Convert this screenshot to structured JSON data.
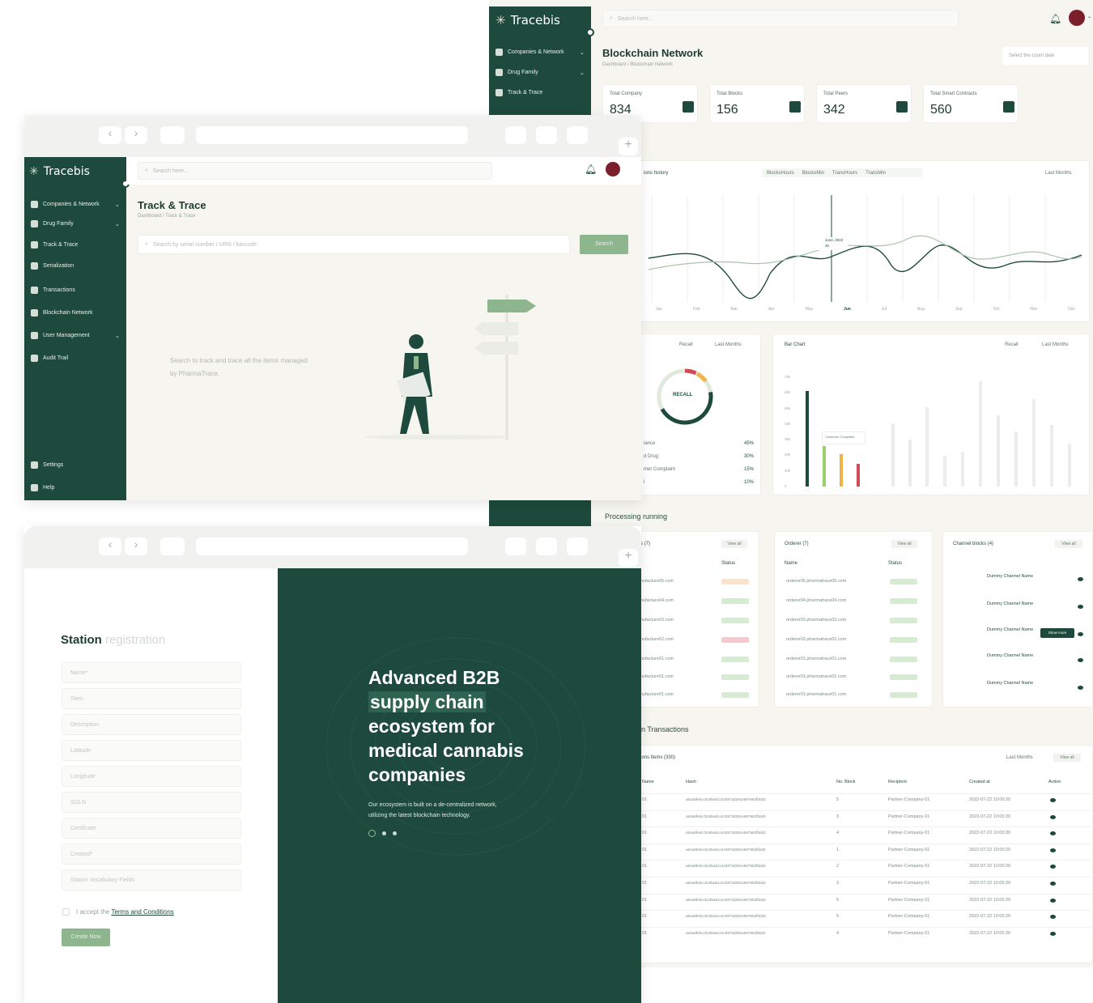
{
  "brand": {
    "name": "Tracebis"
  },
  "sidebar": {
    "items": [
      {
        "label": "Companies & Network",
        "has_chevron": true
      },
      {
        "label": "Drug Family",
        "has_chevron": true
      },
      {
        "label": "Track & Trace",
        "has_chevron": false
      },
      {
        "label": "Serialization",
        "has_chevron": false
      },
      {
        "label": "Transactions",
        "has_chevron": false
      },
      {
        "label": "Blockchain Network",
        "has_chevron": false
      },
      {
        "label": "User Management",
        "has_chevron": true
      },
      {
        "label": "Audit Trail",
        "has_chevron": false
      }
    ],
    "bottom": [
      {
        "label": "Settings"
      },
      {
        "label": "Help"
      }
    ]
  },
  "dashboard": {
    "search_placeholder": "Search here...",
    "title": "Blockchain Network",
    "breadcrumb": "Dashboard / Blockchain Network",
    "date_select": "Select the count date",
    "stats": [
      {
        "label": "Total Company",
        "value": "834"
      },
      {
        "label": "Total Blocks",
        "value": "156"
      },
      {
        "label": "Total Peers",
        "value": "342"
      },
      {
        "label": "Total Smart Contracts",
        "value": "560"
      }
    ],
    "history_title": "ions history",
    "legend": [
      "BlocksHours",
      "BlocksMin",
      "TransHours",
      "TransMin"
    ],
    "period": "Last Months",
    "months": [
      "Jan",
      "Feb",
      "Mar",
      "Apr",
      "May",
      "Jun",
      "Jul",
      "Aug",
      "Sep",
      "Oct",
      "Nov",
      "Dec"
    ],
    "tooltip": {
      "title": "June, 2022",
      "value": "20"
    },
    "donut": {
      "filter1": "Recall",
      "filter2": "Last Months",
      "center": "RECALL",
      "rows": [
        {
          "label": "iance",
          "value": "45%"
        },
        {
          "label": "d Drug",
          "value": "30%"
        },
        {
          "label": "mer Complaint",
          "value": "15%"
        },
        {
          "label": "l",
          "value": "10%"
        }
      ]
    },
    "bar_chart": {
      "title": "Bar Chart",
      "filter1": "Recall",
      "filter2": "Last Months",
      "tooltip": "Customer Complaint",
      "y_ticks": [
        "70k",
        "60k",
        "50k",
        "40k",
        "30k",
        "20k",
        "10k",
        "0"
      ]
    },
    "processing_title": "Processing running",
    "panel1": {
      "title": "s (7)",
      "view_all": "View all",
      "status_header": "Status",
      "rows": [
        "nufacture05.com",
        "nufacture04.com",
        "nufacture03.com",
        "nufacture02.com",
        "nufacture01.com",
        "nufacture01.com",
        "nufacture01.com"
      ]
    },
    "panel2": {
      "title": "Orderer (7)",
      "view_all": "View all",
      "name_header": "Name",
      "status_header": "Status",
      "rows": [
        "orderer05.pharmatrace05.com",
        "orderer04.pharmatrace04.com",
        "orderer03.pharmatrace03.com",
        "orderer02.pharmatrace02.com",
        "orderer01.pharmatrace01.com",
        "orderer01.pharmatrace01.com",
        "orderer01.pharmatrace01.com"
      ]
    },
    "panel3": {
      "title": "Channel blocks (4)",
      "view_all": "View all",
      "show_more": "Show more",
      "rows": [
        "Dummy Channel Name",
        "Dummy Channel Name",
        "Dummy Channel Name",
        "Dummy Channel Name",
        "Dummy Channel Name"
      ]
    },
    "transactions_title": "in Transactions",
    "tx_table": {
      "title": "ions Items (330)",
      "period": "Last Months",
      "view_all": "View all",
      "headers": [
        "Name",
        "Hash",
        "No. Block",
        "Recipient",
        "Created at",
        "Action"
      ],
      "rows": [
        {
          "name": "01",
          "hash": "a94a8fe5ccb19ba61c4c0873d391e987982fbbd3",
          "block": "5",
          "recipient": "Partner-Company-01",
          "created": "2022-07-22 10:00:20"
        },
        {
          "name": "01",
          "hash": "a94a8fe5ccb19ba61c4c0873d391e987982fbbd3",
          "block": "3",
          "recipient": "Partner-Company-01",
          "created": "2022-07-22 10:00:20"
        },
        {
          "name": "01",
          "hash": "a94a8fe5ccb19ba61c4c0873d391e987982fbbd3",
          "block": "4",
          "recipient": "Partner-Company-01",
          "created": "2022-07-22 10:00:20"
        },
        {
          "name": "01",
          "hash": "a94a8fe5ccb19ba61c4c0873d391e987982fbbd3",
          "block": "1",
          "recipient": "Partner-Company-01",
          "created": "2022-07-22 10:00:20"
        },
        {
          "name": "01",
          "hash": "a94a8fe5ccb19ba61c4c0873d391e987982fbbd3",
          "block": "2",
          "recipient": "Partner-Company-01",
          "created": "2022-07-22 10:00:20"
        },
        {
          "name": "01",
          "hash": "a94a8fe5ccb19ba61c4c0873d391e987982fbbd3",
          "block": "3",
          "recipient": "Partner-Company-01",
          "created": "2022-07-22 10:00:20"
        },
        {
          "name": "01",
          "hash": "a94a8fe5ccb19ba61c4c0873d391e987982fbbd3",
          "block": "5",
          "recipient": "Partner-Company-01",
          "created": "2022-07-22 10:00:20"
        },
        {
          "name": "01",
          "hash": "a94a8fe5ccb19ba61c4c0873d391e987982fbbd3",
          "block": "5",
          "recipient": "Partner-Company-01",
          "created": "2022-07-22 10:00:20"
        },
        {
          "name": "01",
          "hash": "a94a8fe5ccb19ba61c4c0873d391e987982fbbd3",
          "block": "4",
          "recipient": "Partner-Company-01",
          "created": "2022-07-22 10:00:20"
        }
      ]
    }
  },
  "track": {
    "title": "Track & Trace",
    "breadcrumb": "Dashboard / Track & Trace",
    "search_placeholder": "Search by serial number / URN / barcode",
    "search_button": "Search",
    "empty_text": "Search to track and trace all the items managed by PharmaTrace."
  },
  "station": {
    "title_bold": "Station",
    "title_light": "registration",
    "fields": [
      "Name*",
      "Sites",
      "Description",
      "Latitude",
      "Longitude",
      "SGLN",
      "Certificate",
      "Created*",
      "Station Vocabulary Fields"
    ],
    "terms_prefix": "I accept the",
    "terms_link": "Terms and Conditions",
    "create_button": "Create Now",
    "hero_lines": [
      "Advanced B2B",
      "supply chain",
      "ecosystem for",
      "medical cannabis",
      "companies"
    ],
    "hero_sub": [
      "Our ecosystem is built on a de-centralized network,",
      "utilizing the latest blockchain technology."
    ]
  },
  "colors": {
    "brand_green": "#1d4a3c",
    "accent_green": "#8db58e",
    "canvas": "#f6f5ef",
    "bar_dark": "#1d4a3c",
    "bar_lime": "#9bd06b",
    "bar_orange": "#f0b24a",
    "bar_red": "#d04a5a"
  }
}
